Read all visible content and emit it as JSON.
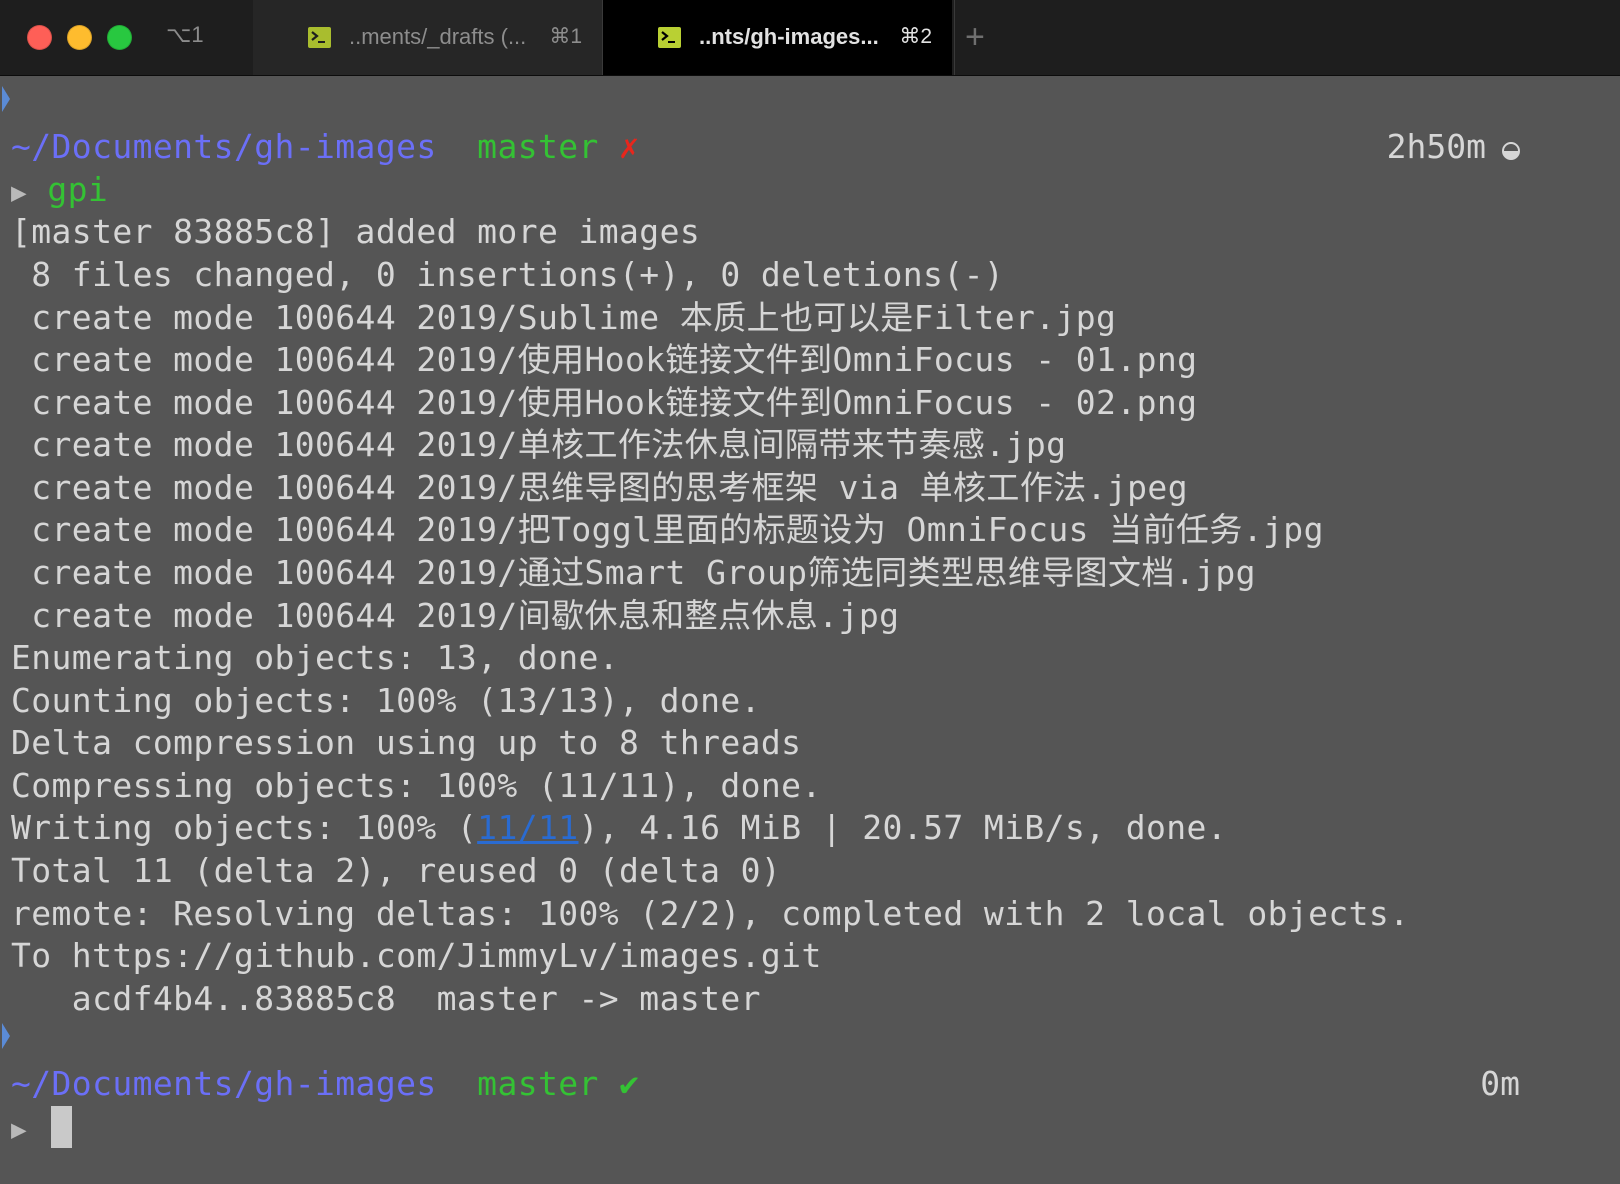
{
  "window": {
    "shortcut_label": "⌥1"
  },
  "tabs": [
    {
      "title": "..ments/_drafts (...",
      "shortcut": "⌘1",
      "active": false
    },
    {
      "title": "..nts/gh-images...",
      "shortcut": "⌘2",
      "active": true
    }
  ],
  "new_tab_label": "+",
  "prompt_top": {
    "path": "~/Documents/gh-images",
    "branch": "master",
    "status_symbol": "✗",
    "elapsed": "2h50m",
    "prompt_char": "▶",
    "command": "gpi"
  },
  "output": [
    "[master 83885c8] added more images",
    " 8 files changed, 0 insertions(+), 0 deletions(-)",
    " create mode 100644 2019/Sublime 本质上也可以是Filter.jpg",
    " create mode 100644 2019/使用Hook链接文件到OmniFocus - 01.png",
    " create mode 100644 2019/使用Hook链接文件到OmniFocus - 02.png",
    " create mode 100644 2019/单核工作法休息间隔带来节奏感.jpg",
    " create mode 100644 2019/思维导图的思考框架 via 单核工作法.jpeg",
    " create mode 100644 2019/把Toggl里面的标题设为 OmniFocus 当前任务.jpg",
    " create mode 100644 2019/通过Smart Group筛选同类型思维导图文档.jpg",
    " create mode 100644 2019/间歇休息和整点休息.jpg",
    "Enumerating objects: 13, done.",
    "Counting objects: 100% (13/13), done.",
    "Delta compression using up to 8 threads",
    "Compressing objects: 100% (11/11), done."
  ],
  "writing_line": {
    "prefix": "Writing objects: 100% (",
    "link": "11/11",
    "suffix": "), 4.16 MiB | 20.57 MiB/s, done."
  },
  "output_tail": [
    "Total 11 (delta 2), reused 0 (delta 0)",
    "remote: Resolving deltas: 100% (2/2), completed with 2 local objects.",
    "To https://github.com/JimmyLv/images.git",
    "   acdf4b4..83885c8  master -> master"
  ],
  "prompt_bottom": {
    "path": "~/Documents/gh-images",
    "branch": "master",
    "status_symbol": "✔",
    "elapsed": "0m",
    "prompt_char": "▶"
  },
  "colors": {
    "terminal_bg": "#555555",
    "path": "#6b6ff7",
    "branch": "#34c234",
    "dirty": "#e8261c",
    "text": "#d6d6d6",
    "link": "#2a6bd1",
    "term_icon": "#b9d033"
  },
  "icons": {
    "tab_icon": "terminal-icon",
    "elapsed_icon": "half-circle-icon"
  }
}
